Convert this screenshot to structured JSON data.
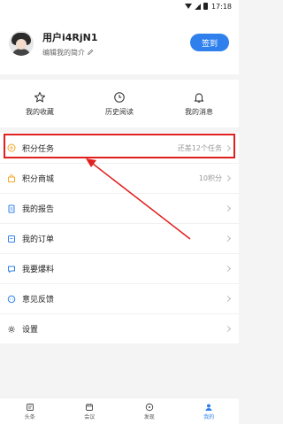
{
  "status_bar": {
    "time": "17:18"
  },
  "profile": {
    "username": "用户i4RjN1",
    "bio": "编辑我的简介",
    "signin_label": "签到"
  },
  "quick_actions": [
    {
      "label": "我的收藏",
      "icon": "star-icon"
    },
    {
      "label": "历史阅读",
      "icon": "clock-icon"
    },
    {
      "label": "我的消息",
      "icon": "bell-icon"
    }
  ],
  "menu": [
    {
      "label": "积分任务",
      "right": "还差12个任务",
      "icon": "points-task-icon"
    },
    {
      "label": "积分商城",
      "right": "10积分",
      "icon": "shop-icon"
    },
    {
      "label": "我的报告",
      "right": "",
      "icon": "report-icon"
    },
    {
      "label": "我的订单",
      "right": "",
      "icon": "order-icon"
    },
    {
      "label": "我要爆料",
      "right": "",
      "icon": "tipoff-icon"
    },
    {
      "label": "意见反馈",
      "right": "",
      "icon": "feedback-icon"
    },
    {
      "label": "设置",
      "right": "",
      "icon": "settings-icon"
    }
  ],
  "bottom_nav": [
    {
      "label": "头条",
      "icon": "headline-icon"
    },
    {
      "label": "会议",
      "icon": "meeting-icon"
    },
    {
      "label": "发现",
      "icon": "discover-icon"
    },
    {
      "label": "我的",
      "icon": "profile-icon"
    }
  ],
  "colors": {
    "accent": "#2f80ed",
    "highlight": "#e0201e",
    "task_icon": "#f5a623",
    "menu_icon": "#2f80ed"
  }
}
